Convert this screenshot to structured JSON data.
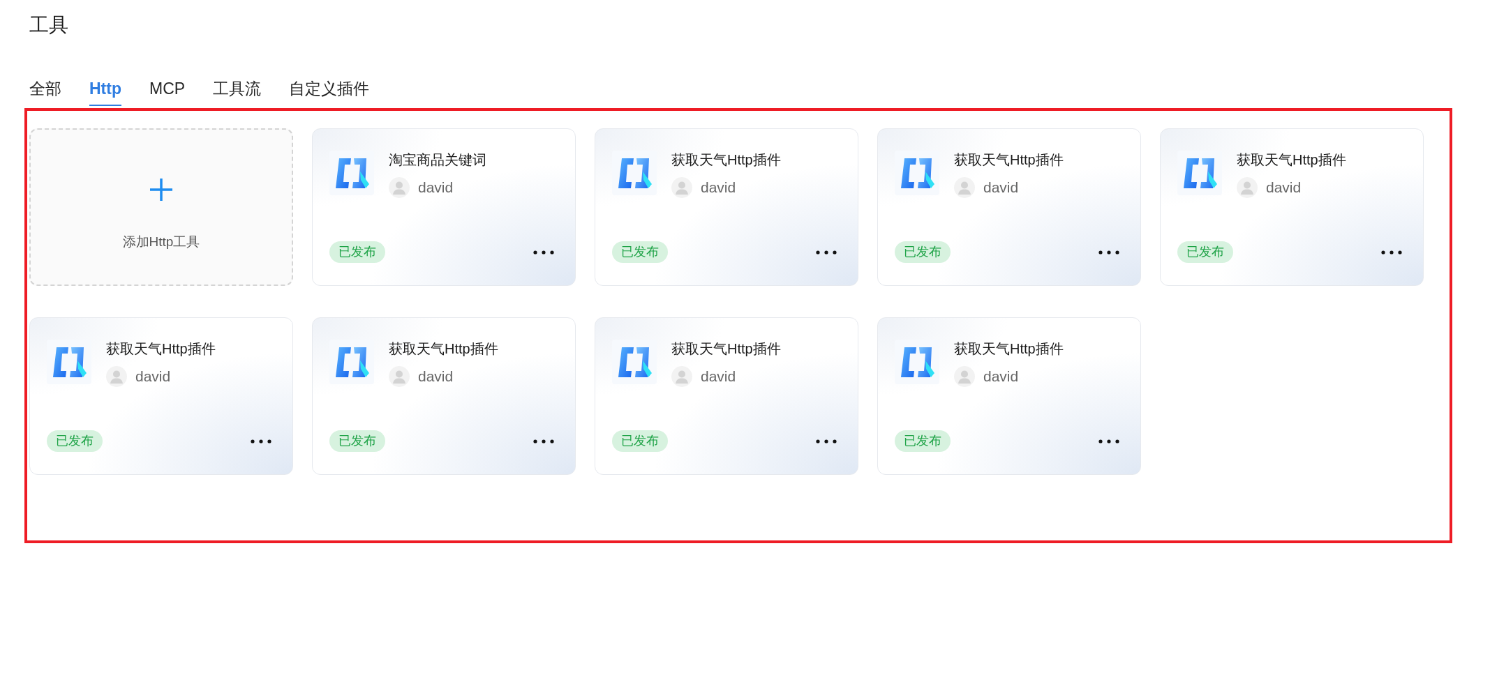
{
  "page_title": "工具",
  "tabs": [
    {
      "label": "全部",
      "selected": false
    },
    {
      "label": "Http",
      "selected": true
    },
    {
      "label": "MCP",
      "selected": false
    },
    {
      "label": "工具流",
      "selected": false
    },
    {
      "label": "自定义插件",
      "selected": false
    }
  ],
  "add_tool": {
    "label": "添加Http工具"
  },
  "tools": [
    {
      "name": "淘宝商品关键词",
      "author": "david",
      "status": "已发布"
    },
    {
      "name": "获取天气Http插件",
      "author": "david",
      "status": "已发布"
    },
    {
      "name": "获取天气Http插件",
      "author": "david",
      "status": "已发布"
    },
    {
      "name": "获取天气Http插件",
      "author": "david",
      "status": "已发布"
    },
    {
      "name": "获取天气Http插件",
      "author": "david",
      "status": "已发布"
    },
    {
      "name": "获取天气Http插件",
      "author": "david",
      "status": "已发布"
    },
    {
      "name": "获取天气Http插件",
      "author": "david",
      "status": "已发布"
    },
    {
      "name": "获取天气Http插件",
      "author": "david",
      "status": "已发布"
    }
  ]
}
